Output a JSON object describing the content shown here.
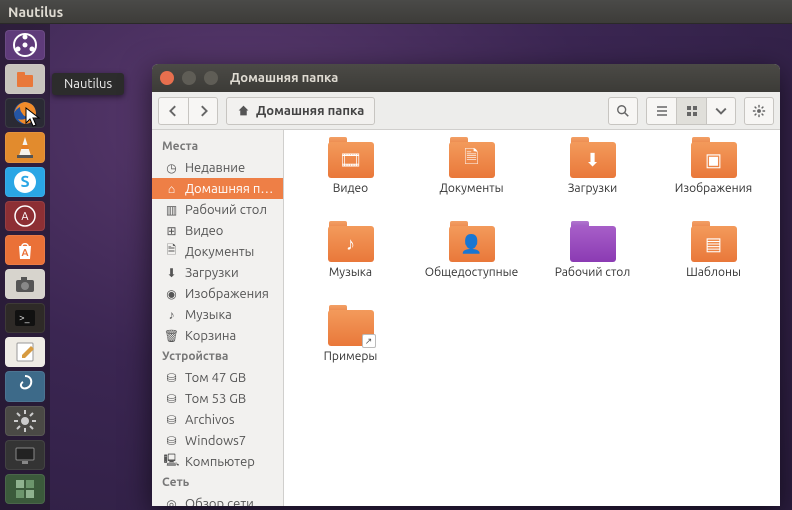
{
  "menubar": {
    "app": "Nautilus"
  },
  "tooltip": "Nautilus",
  "launcher": [
    {
      "name": "dash-icon",
      "bg": "#5f3b7a",
      "svg": "dash"
    },
    {
      "name": "nautilus-icon",
      "bg": "#c8c4bd",
      "svg": "files"
    },
    {
      "name": "firefox-icon",
      "bg": "#2a2a34",
      "svg": "firefox"
    },
    {
      "name": "vlc-icon",
      "bg": "#e28b2d",
      "svg": "cone"
    },
    {
      "name": "skype-icon",
      "bg": "#2aa6e5",
      "svg": "skype"
    },
    {
      "name": "update-icon",
      "bg": "#8d2f34",
      "svg": "update"
    },
    {
      "name": "software-center-icon",
      "bg": "#ea7137",
      "svg": "bag"
    },
    {
      "name": "screenshot-icon",
      "bg": "#d7d4cd",
      "svg": "camera"
    },
    {
      "name": "terminal-icon",
      "bg": "#2e2a27",
      "svg": "term"
    },
    {
      "name": "text-editor-icon",
      "bg": "#efece5",
      "svg": "edit"
    },
    {
      "name": "settings-icon",
      "bg": "#3d6a89",
      "svg": "swirl"
    },
    {
      "name": "system-settings-icon",
      "bg": "#4a4945",
      "svg": "gear"
    },
    {
      "name": "display-icon",
      "bg": "#343434",
      "svg": "disp"
    },
    {
      "name": "workspace-icon",
      "bg": "#3b5a3b",
      "svg": "grid"
    }
  ],
  "window": {
    "title": "Домашняя папка",
    "breadcrumb": "Домашняя папка"
  },
  "sidebar": {
    "sections": [
      {
        "title": "Места",
        "items": [
          {
            "icon": "clock",
            "label": "Недавние",
            "active": false
          },
          {
            "icon": "home",
            "label": "Домашняя п…",
            "active": true
          },
          {
            "icon": "desktop",
            "label": "Рабочий стол",
            "active": false
          },
          {
            "icon": "video",
            "label": "Видео",
            "active": false
          },
          {
            "icon": "doc",
            "label": "Документы",
            "active": false
          },
          {
            "icon": "down",
            "label": "Загрузки",
            "active": false
          },
          {
            "icon": "pic",
            "label": "Изображения",
            "active": false
          },
          {
            "icon": "music",
            "label": "Музыка",
            "active": false
          },
          {
            "icon": "trash",
            "label": "Корзина",
            "active": false
          }
        ]
      },
      {
        "title": "Устройства",
        "items": [
          {
            "icon": "hdd",
            "label": "Том 47 GB",
            "active": false
          },
          {
            "icon": "hdd",
            "label": "Том 53 GB",
            "active": false
          },
          {
            "icon": "hdd",
            "label": "Archivos",
            "active": false
          },
          {
            "icon": "hdd",
            "label": "Windows7",
            "active": false
          },
          {
            "icon": "pc",
            "label": "Компьютер",
            "active": false
          }
        ]
      },
      {
        "title": "Сеть",
        "items": [
          {
            "icon": "net",
            "label": "Обзор сети",
            "active": false
          }
        ]
      }
    ]
  },
  "folders": [
    {
      "label": "Видео",
      "glyph": "film",
      "variant": ""
    },
    {
      "label": "Документы",
      "glyph": "doc",
      "variant": ""
    },
    {
      "label": "Загрузки",
      "glyph": "down",
      "variant": ""
    },
    {
      "label": "Изображения",
      "glyph": "pic",
      "variant": ""
    },
    {
      "label": "Музыка",
      "glyph": "music",
      "variant": ""
    },
    {
      "label": "Общедоступные",
      "glyph": "share",
      "variant": ""
    },
    {
      "label": "Рабочий стол",
      "glyph": "",
      "variant": "desktop"
    },
    {
      "label": "Шаблоны",
      "glyph": "tmpl",
      "variant": ""
    },
    {
      "label": "Примеры",
      "glyph": "",
      "variant": "link"
    }
  ]
}
